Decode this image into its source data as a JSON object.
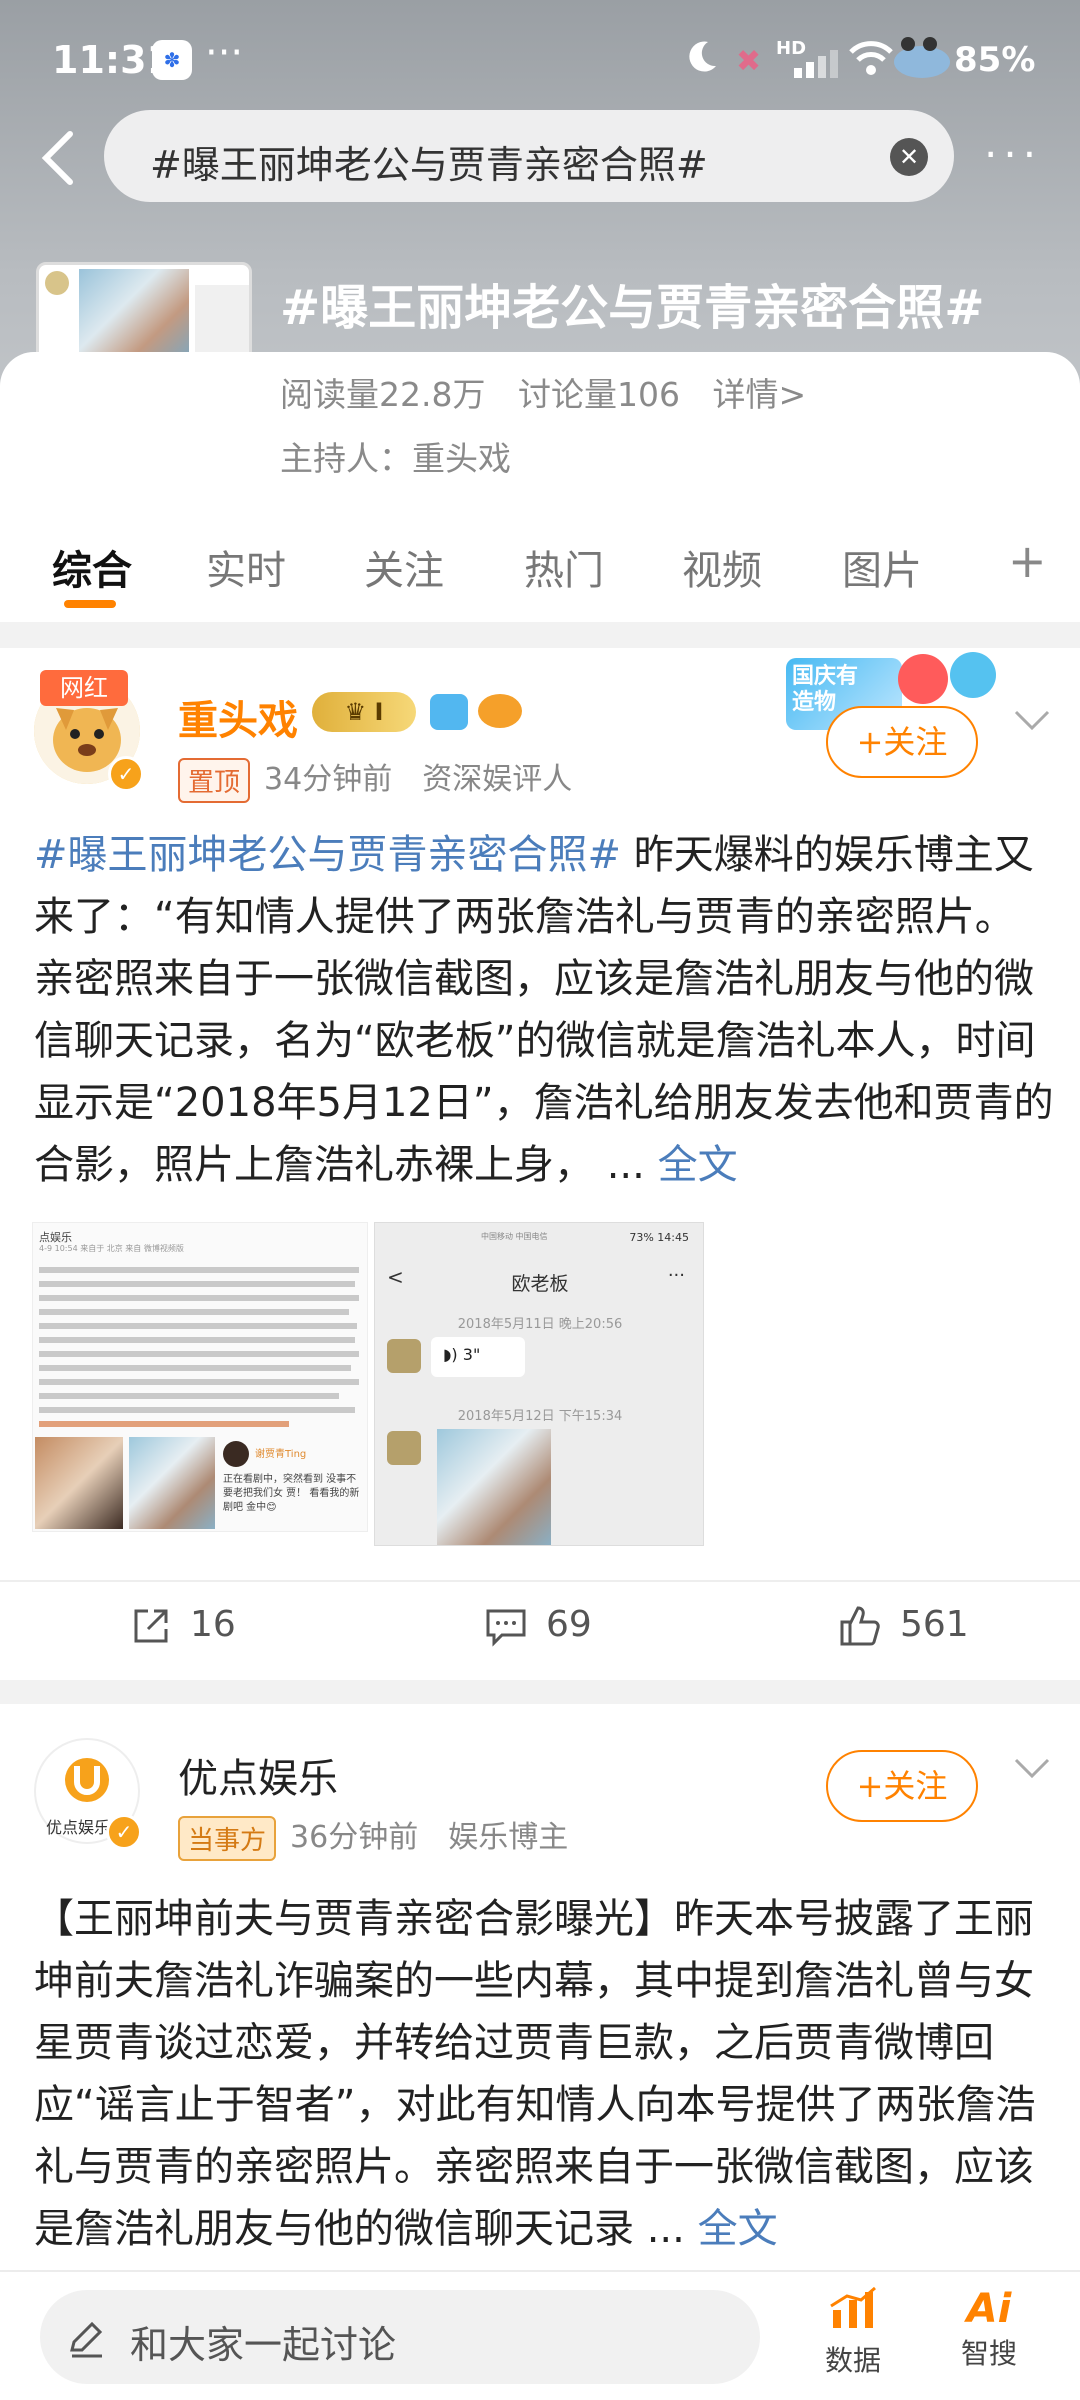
{
  "status_bar": {
    "time": "11:31",
    "dots": "···",
    "hd": "HD",
    "battery": "85%"
  },
  "search": {
    "query": "#曝王丽坤老公与贾青亲密合照#",
    "more": "···"
  },
  "topic": {
    "title": "#曝王丽坤老公与贾青亲密合照#",
    "read": "阅读量22.8万",
    "discuss": "讨论量106",
    "detail": "详情>",
    "host": "主持人：重头戏"
  },
  "tabs": [
    {
      "label": "综合"
    },
    {
      "label": "实时"
    },
    {
      "label": "关注"
    },
    {
      "label": "热门"
    },
    {
      "label": "视频"
    },
    {
      "label": "图片"
    }
  ],
  "tab_plus": "+",
  "posts": [
    {
      "user": "重头戏",
      "badge_text": "网红",
      "tag": "置顶",
      "time": "34分钟前",
      "role": "资深娱评人",
      "follow": "+关注",
      "promo": "国庆有\n造物",
      "hashtag": "#曝王丽坤老公与贾青亲密合照#",
      "text": " 昨天爆料的娱乐博主又来了：“有知情人提供了两张詹浩礼与贾青的亲密照片。亲密照来自于一张微信截图，应该是詹浩礼朋友与他的微信聊天记录，名为“欧老板”的微信就是詹浩礼本人，时间显示是“2018年5月12日”，詹浩礼给朋友发去他和贾青的合影，照片上詹浩礼赤裸上身，",
      "ellipsis": " ... ",
      "full": "全文",
      "image1": {
        "source": "点娱乐",
        "meta": "4-9 10:54 来自于 北京 来自 微博视频版",
        "label_user": "谢贾青Ting",
        "label_text": "正在看剧中，突然看到 没事不要老把我们女 贾！ 看看我的新剧吧 金中😊"
      },
      "image2": {
        "status_left": "中国移动 中国电信",
        "status_right": "73% 14:45",
        "back": "<",
        "title": "欧老板",
        "menu": "···",
        "time1": "2018年5月11日 晚上20:56",
        "voice": "3\"",
        "time2": "2018年5月12日 下午15:34"
      },
      "shares": "16",
      "comments": "69",
      "likes": "561"
    },
    {
      "user": "优点娱乐",
      "avatar_text": "优点娱乐",
      "tag": "当事方",
      "time": "36分钟前",
      "role": "娱乐博主",
      "follow": "+关注",
      "text": "【王丽坤前夫与贾青亲密合影曝光】昨天本号披露了王丽坤前夫詹浩礼诈骗案的一些内幕，其中提到詹浩礼曾与女星贾青谈过恋爱，并转给过贾青巨款，之后贾青微博回应“谣言止于智者”，对此有知情人向本号提供了两张詹浩礼与贾青的亲密照片。亲密照来自于一张微信截图，应该是詹浩礼朋友与他的微信聊天记录",
      "ellipsis": " ... ",
      "full": "全文"
    }
  ],
  "bottom": {
    "placeholder": "和大家一起讨论",
    "data_label": "数据",
    "ai_label": "智搜",
    "ai_icon": "Ai"
  },
  "colors": {
    "accent": "#ff8200",
    "link": "#4b7dbb"
  }
}
